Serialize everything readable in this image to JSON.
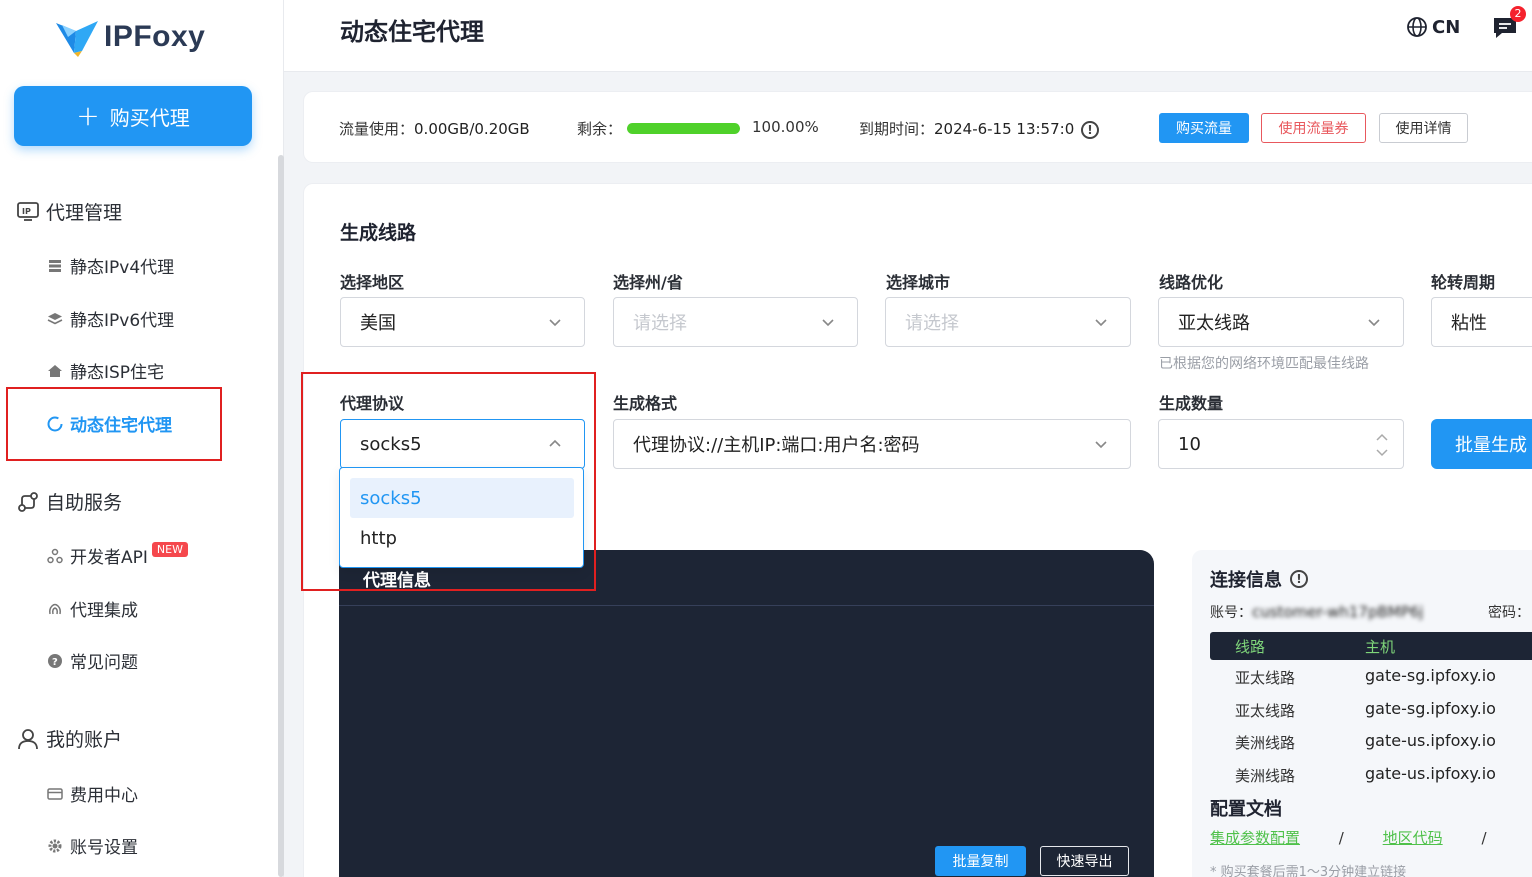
{
  "brand": {
    "name": "IPFoxy"
  },
  "sidebar": {
    "buy_button": "购买代理",
    "groups": [
      {
        "label": "代理管理",
        "items": [
          {
            "label": "静态IPv4代理"
          },
          {
            "label": "静态IPv6代理"
          },
          {
            "label": "静态ISP住宅"
          },
          {
            "label": "动态住宅代理",
            "active": true
          }
        ]
      },
      {
        "label": "自助服务",
        "items": [
          {
            "label": "开发者API",
            "badge": "NEW"
          },
          {
            "label": "代理集成"
          },
          {
            "label": "常见问题"
          }
        ]
      },
      {
        "label": "我的账户",
        "items": [
          {
            "label": "费用中心"
          },
          {
            "label": "账号设置"
          }
        ]
      }
    ]
  },
  "header": {
    "title": "动态住宅代理",
    "language": "CN",
    "message_count": "2"
  },
  "usage": {
    "traffic_label": "流量使用：",
    "traffic_value": "0.00GB/0.20GB",
    "remaining_label": "剩余：",
    "remaining_fraction": 1.0,
    "remaining_value": "100.00%",
    "expire_label": "到期时间：",
    "expire_value": "2024-6-15 13:57:0",
    "buttons": {
      "buy_traffic": "购买流量",
      "use_coupon": "使用流量券",
      "details": "使用详情"
    }
  },
  "generate": {
    "title": "生成线路",
    "region": {
      "label": "选择地区",
      "value": "美国"
    },
    "state": {
      "label": "选择州/省",
      "placeholder": "请选择"
    },
    "city": {
      "label": "选择城市",
      "placeholder": "请选择"
    },
    "route": {
      "label": "线路优化",
      "value": "亚太线路",
      "hint": "已根据您的网络环境匹配最佳线路"
    },
    "rotation": {
      "label": "轮转周期",
      "value": "粘性"
    },
    "protocol": {
      "label": "代理协议",
      "value": "socks5",
      "options": [
        "socks5",
        "http"
      ]
    },
    "format": {
      "label": "生成格式",
      "value": "代理协议://主机IP:端口:用户名:密码"
    },
    "count": {
      "label": "生成数量",
      "value": "10"
    },
    "batch_button": "批量生成"
  },
  "proxy_info": {
    "title": "代理信息",
    "copy_button": "批量复制",
    "export_button": "快速导出"
  },
  "connection": {
    "title": "连接信息",
    "account_label": "账号：",
    "account_value": "customer-wh17pBMP6j",
    "password_label": "密码：",
    "columns": [
      "线路",
      "主机"
    ],
    "rows": [
      {
        "route": "亚太线路",
        "host": "gate-sg.ipfoxy.io"
      },
      {
        "route": "亚太线路",
        "host": "gate-sg.ipfoxy.io"
      },
      {
        "route": "美洲线路",
        "host": "gate-us.ipfoxy.io"
      },
      {
        "route": "美洲线路",
        "host": "gate-us.ipfoxy.io"
      }
    ],
    "doc_title": "配置文档",
    "doc_link1": "集成参数配置",
    "doc_link2": "地区代码",
    "separator": "/",
    "note": "* 购买套餐后需1～3分钟建立链接"
  },
  "colors": {
    "accent": "#2196f3",
    "progress": "#4fd12a",
    "danger": "#e02020",
    "dark_panel": "#1d2535"
  }
}
